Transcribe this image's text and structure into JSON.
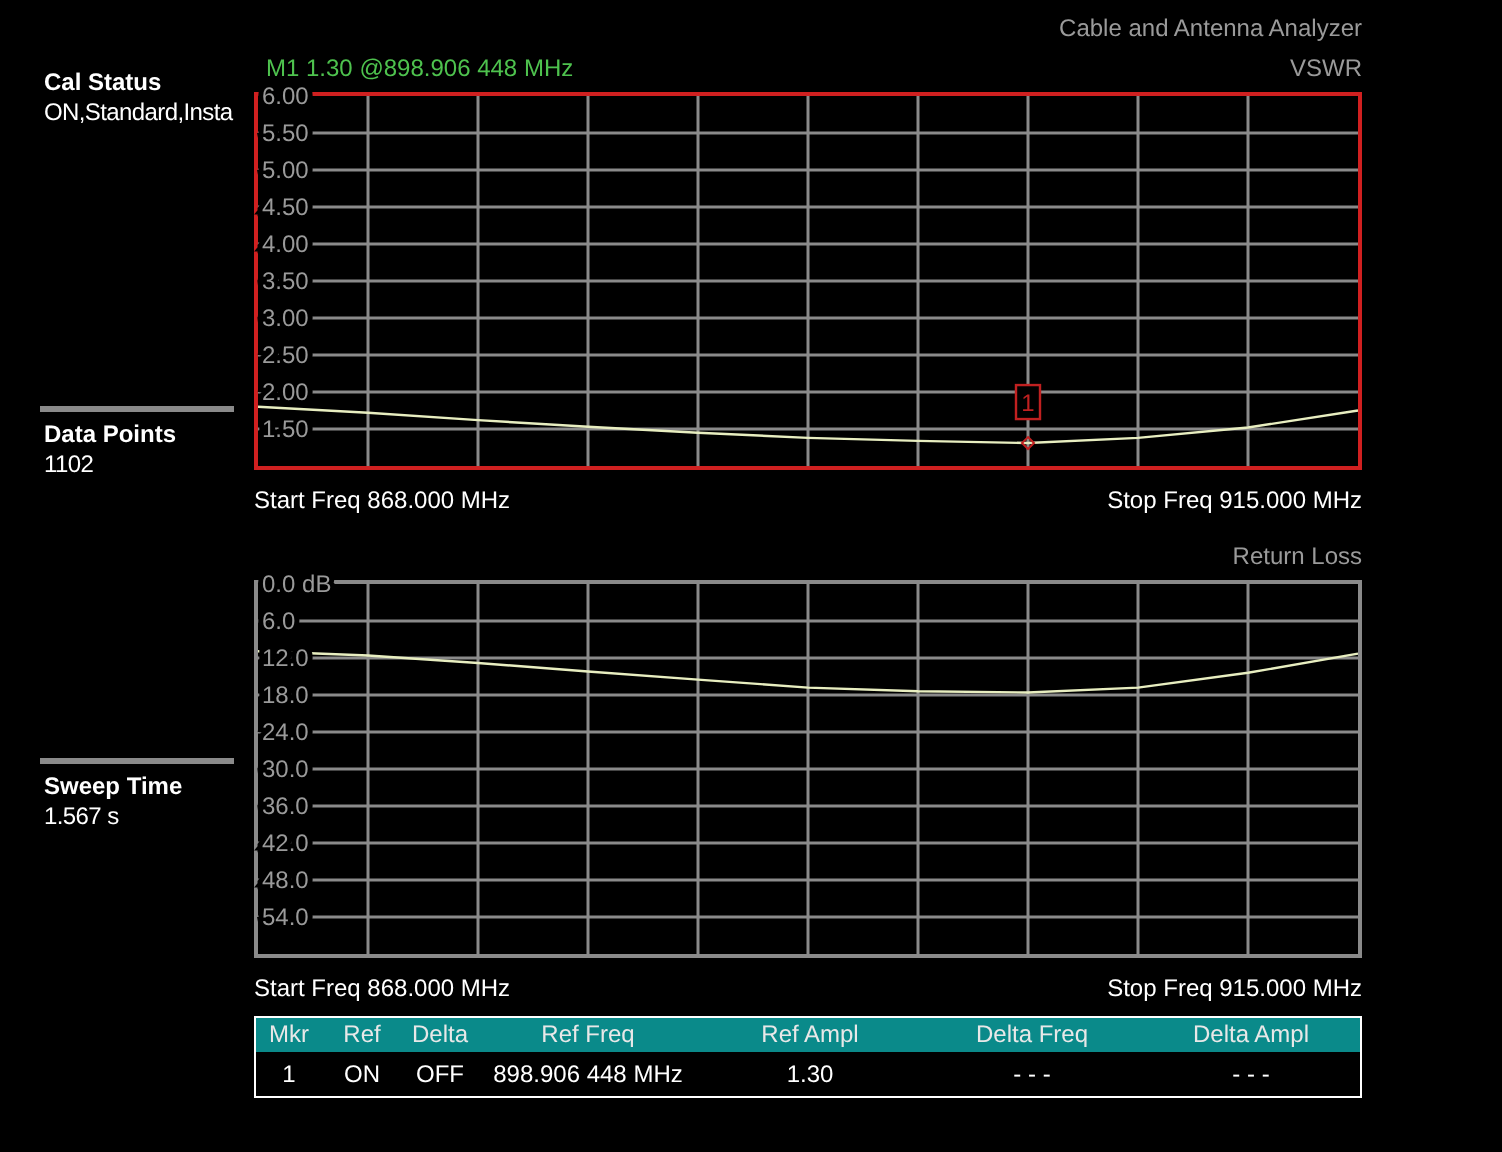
{
  "header": {
    "instrument": "Cable and Antenna Analyzer"
  },
  "side_panel": [
    {
      "title": "Cal Status",
      "value": "ON,Standard,Insta"
    },
    {
      "title": "Data Points",
      "value": "1102"
    },
    {
      "title": "Sweep Time",
      "value": "1.567 s"
    }
  ],
  "plots": [
    {
      "marker_readout": "M1 1.30 @898.906 448 MHz",
      "active": true,
      "start_freq": "Start Freq 868.000 MHz",
      "stop_freq": "Stop Freq 915.000 MHz",
      "chart_data": {
        "type": "line",
        "grid": true,
        "categories": [
          null,
          null,
          null,
          null,
          null,
          null,
          null,
          null,
          null,
          null,
          null
        ],
        "ylim": [
          1,
          6
        ],
        "yticks": [
          {
            "value": 6,
            "label": "6.00"
          },
          {
            "value": 5.5,
            "label": "5.50"
          },
          {
            "value": 5,
            "label": "5.00"
          },
          {
            "value": 4.5,
            "label": "4.50"
          },
          {
            "value": 4,
            "label": "4.00"
          },
          {
            "value": 3.5,
            "label": "3.50"
          },
          {
            "value": 3,
            "label": "3.00"
          },
          {
            "value": 2.5,
            "label": "2.50"
          },
          {
            "value": 2,
            "label": "2.00"
          },
          {
            "value": 1.5,
            "label": "1.50"
          }
        ],
        "series": [
          {
            "name": "VSWR",
            "color": "#e8eec0",
            "values": [
              1.8,
              1.72,
              1.62,
              1.53,
              1.45,
              1.38,
              1.34,
              1.31,
              1.38,
              1.52,
              1.75
            ]
          }
        ],
        "annotations": [
          {
            "text": "1"
          }
        ]
      }
    },
    {
      "active": false,
      "start_freq": "Start Freq 868.000 MHz",
      "stop_freq": "Stop Freq 915.000 MHz",
      "chart_data": {
        "type": "line",
        "grid": true,
        "categories": [
          null,
          null,
          null,
          null,
          null,
          null,
          null,
          null,
          null,
          null,
          null
        ],
        "ylim": [
          60,
          0
        ],
        "yticks": [
          {
            "value": 0,
            "label": "0.0 dB"
          },
          {
            "value": 6,
            "label": "6.0"
          },
          {
            "value": 12,
            "label": "12.0"
          },
          {
            "value": 18,
            "label": "18.0"
          },
          {
            "value": 24,
            "label": "24.0"
          },
          {
            "value": 30,
            "label": "30.0"
          },
          {
            "value": 36,
            "label": "36.0"
          },
          {
            "value": 42,
            "label": "42.0"
          },
          {
            "value": 48,
            "label": "48.0"
          },
          {
            "value": 54,
            "label": "54.0"
          }
        ],
        "series": [
          {
            "name": "Return Loss",
            "color": "#e8eec0",
            "values": [
              10.9,
              11.6,
              12.8,
              14.2,
              15.5,
              16.8,
              17.4,
              17.6,
              16.8,
              14.4,
              11.3
            ]
          }
        ]
      }
    }
  ],
  "marker_table": {
    "columns": [
      "Mkr",
      "Ref",
      "Delta",
      "Ref Freq",
      "Ref Ampl",
      "Delta Freq",
      "Delta Ampl"
    ],
    "rows": [
      [
        "1",
        "ON",
        "OFF",
        "898.906 448 MHz",
        "1.30",
        "- - -",
        "- - -"
      ]
    ]
  }
}
